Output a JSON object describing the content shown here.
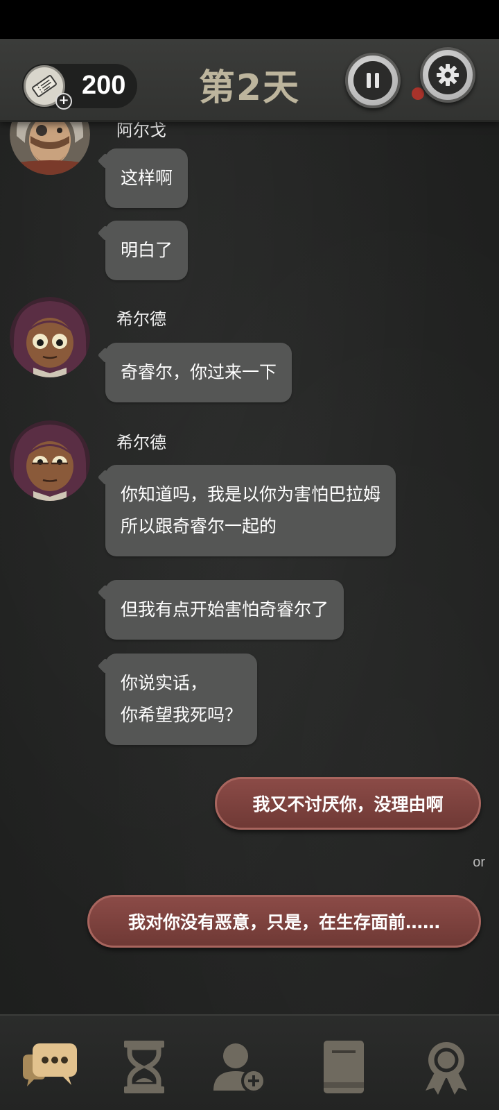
{
  "header": {
    "ticket_count": "200",
    "day_title": "第2天"
  },
  "chat": {
    "cut_sender_name": "阿尔戈",
    "messages": [
      {
        "text": "这样啊"
      },
      {
        "text": "明白了"
      },
      {
        "sender": "希尔德",
        "text": "奇睿尔，你过来一下"
      },
      {
        "sender": "希尔德",
        "lines": [
          "你知道吗，我是以你为害怕巴拉姆",
          "所以跟奇睿尔一起的"
        ]
      },
      {
        "text": "但我有点开始害怕奇睿尔了"
      },
      {
        "lines": [
          "你说实话，",
          "你希望我死吗？"
        ]
      }
    ],
    "choices": [
      {
        "text": "我又不讨厌你，没理由啊"
      },
      {
        "text": "我对你没有恶意，只是，在生存面前……"
      }
    ],
    "or_label": "or"
  },
  "nav": {
    "items": [
      {
        "icon": "chat-bubbles-icon",
        "active": true
      },
      {
        "icon": "hourglass-icon",
        "active": false
      },
      {
        "icon": "add-person-icon",
        "active": false
      },
      {
        "icon": "book-icon",
        "active": false
      },
      {
        "icon": "achievement-medal-icon",
        "active": false
      }
    ]
  },
  "colors": {
    "background": "#222322",
    "bubble": "#555655",
    "choice": "#7a423e",
    "title": "#bdb59d",
    "nav_active": "#d6b98a",
    "nav_inactive": "#6f6a5f"
  }
}
